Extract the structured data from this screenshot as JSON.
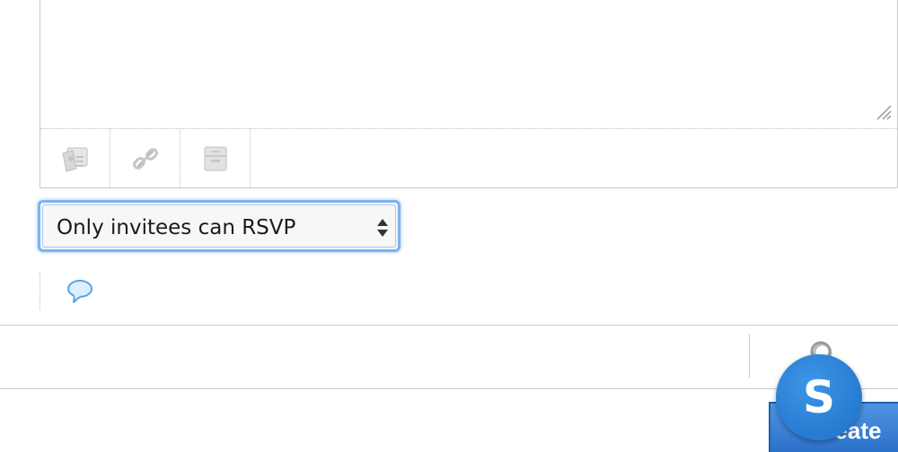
{
  "editor": {
    "text_value": "",
    "toolbar": [
      {
        "icon": "image-icon",
        "label": "Insert image"
      },
      {
        "icon": "link-icon",
        "label": "Insert link"
      },
      {
        "icon": "archive-icon",
        "label": "Insert file"
      }
    ]
  },
  "rsvp_select": {
    "selected": "Only invitees can RSVP"
  },
  "comment": {
    "icon": "speech-bubble-icon"
  },
  "bottom_bar": {
    "icon": "search-icon"
  },
  "create_button": {
    "label": "Create"
  },
  "floating_avatar": {
    "letter": "S"
  },
  "colors": {
    "accent": "#2a6fc8",
    "select_focus": "#7fb2ef",
    "border": "#c9c9c9"
  }
}
